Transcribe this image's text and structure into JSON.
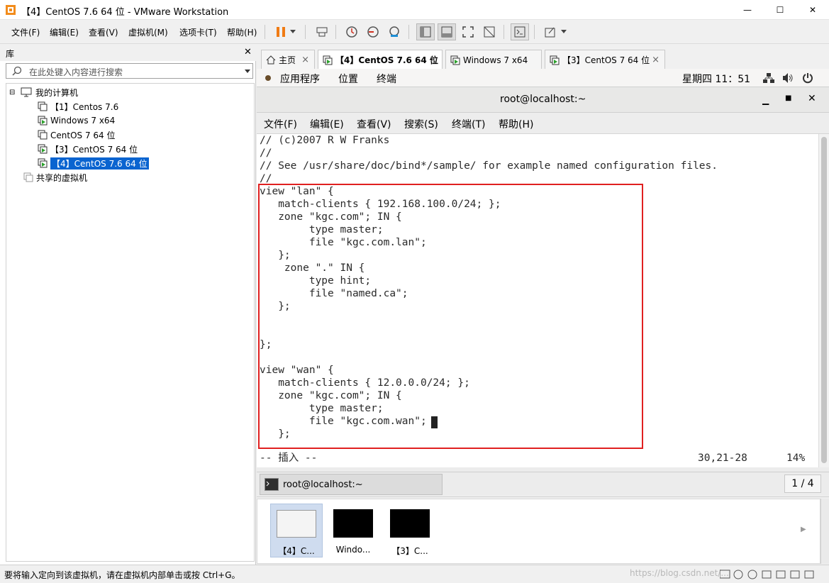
{
  "window": {
    "title": "【4】CentOS 7.6 64 位 - VMware Workstation",
    "controls": {
      "minimize": "—",
      "maximize": "☐",
      "close": "✕"
    }
  },
  "menu": [
    "文件(F)",
    "编辑(E)",
    "查看(V)",
    "虚拟机(M)",
    "选项卡(T)",
    "帮助(H)"
  ],
  "library": {
    "title": "库",
    "close": "✕",
    "search_placeholder": "在此处键入内容进行搜索",
    "tree": {
      "root": "我的计算机",
      "items": [
        "【1】Centos 7.6",
        "Windows 7 x64",
        "CentOS 7 64 位",
        "【3】CentOS 7 64 位",
        "【4】CentOS 7.6 64 位"
      ],
      "shared": "共享的虚拟机"
    }
  },
  "tabs": [
    {
      "label": "主页"
    },
    {
      "label": "【4】CentOS 7.6 64 位"
    },
    {
      "label": "Windows 7 x64"
    },
    {
      "label": "【3】CentOS 7 64 位"
    }
  ],
  "gnome": {
    "apps": "应用程序",
    "places": "位置",
    "terminal": "终端",
    "clock": "星期四 11：51"
  },
  "terminal": {
    "title": "root@localhost:~",
    "menu": [
      "文件(F)",
      "编辑(E)",
      "查看(V)",
      "搜索(S)",
      "终端(T)",
      "帮助(H)"
    ],
    "lines": [
      "// (c)2007 R W Franks",
      "//",
      "// See /usr/share/doc/bind*/sample/ for example named configuration files.",
      "//",
      "view \"lan\" {",
      "   match-clients { 192.168.100.0/24; };",
      "   zone \"kgc.com\"; IN {",
      "        type master;",
      "        file \"kgc.com.lan\";",
      "   };",
      "    zone \".\" IN {",
      "        type hint;",
      "        file \"named.ca\";",
      "   };",
      "",
      "",
      "};",
      "",
      "view \"wan\" {",
      "   match-clients { 12.0.0.0/24; };",
      "   zone \"kgc.com\"; IN {",
      "        type master;",
      "        file \"kgc.com.wan\";",
      "   };"
    ],
    "status_mode": "-- 插入 --",
    "status_pos": "30,21-28",
    "status_pct": "14%",
    "taskbar_item": "root@localhost:~",
    "page": "1 / 4"
  },
  "thumbnails": [
    "【4】C...",
    "Windo...",
    "【3】C..."
  ],
  "statusbar": {
    "text": "要将输入定向到该虚拟机，请在虚拟机内部单击或按 Ctrl+G。",
    "watermark": "https://blog.csdn.net/..."
  },
  "colors": {
    "selection": "#0a64d0",
    "highlight_box": "#e02020",
    "pause": "#f07b14"
  }
}
